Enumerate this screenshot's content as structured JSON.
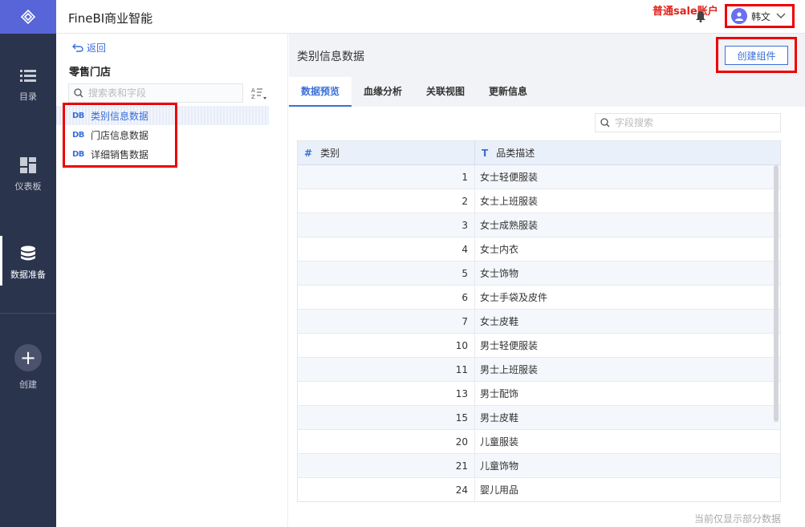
{
  "app": {
    "title": "FineBI商业智能"
  },
  "annotation": "普通sale账户",
  "user": {
    "name": "韩文"
  },
  "nav": {
    "items": [
      {
        "label": "目录",
        "icon": "list-icon"
      },
      {
        "label": "仪表板",
        "icon": "dashboard-icon"
      },
      {
        "label": "数据准备",
        "icon": "database-icon"
      },
      {
        "label": "创建",
        "icon": "plus-icon"
      }
    ]
  },
  "panel": {
    "back_label": "返回",
    "store_title": "零售门店",
    "search_placeholder": "搜索表和字段",
    "db_badge": "DB",
    "tables": [
      {
        "label": "类别信息数据"
      },
      {
        "label": "门店信息数据"
      },
      {
        "label": "详细销售数据"
      }
    ]
  },
  "main": {
    "title": "类别信息数据",
    "create_label": "创建组件",
    "tabs": [
      {
        "label": "数据预览"
      },
      {
        "label": "血缘分析"
      },
      {
        "label": "关联视图"
      },
      {
        "label": "更新信息"
      }
    ],
    "field_search_placeholder": "字段搜索",
    "columns": [
      {
        "type_symbol": "#",
        "label": "类别"
      },
      {
        "type_symbol": "T",
        "label": "品类描述"
      }
    ],
    "rows": [
      {
        "id": "1",
        "desc": "女士轻便服装"
      },
      {
        "id": "2",
        "desc": "女士上班服装"
      },
      {
        "id": "3",
        "desc": "女士成熟服装"
      },
      {
        "id": "4",
        "desc": "女士内衣"
      },
      {
        "id": "5",
        "desc": "女士饰物"
      },
      {
        "id": "6",
        "desc": "女士手袋及皮件"
      },
      {
        "id": "7",
        "desc": "女士皮鞋"
      },
      {
        "id": "10",
        "desc": "男士轻便服装"
      },
      {
        "id": "11",
        "desc": "男士上班服装"
      },
      {
        "id": "13",
        "desc": "男士配饰"
      },
      {
        "id": "15",
        "desc": "男士皮鞋"
      },
      {
        "id": "20",
        "desc": "儿童服装"
      },
      {
        "id": "21",
        "desc": "儿童饰物"
      },
      {
        "id": "24",
        "desc": "婴儿用品"
      },
      {
        "id": "",
        "desc": ""
      }
    ],
    "footnote": "当前仅显示部分数据"
  }
}
